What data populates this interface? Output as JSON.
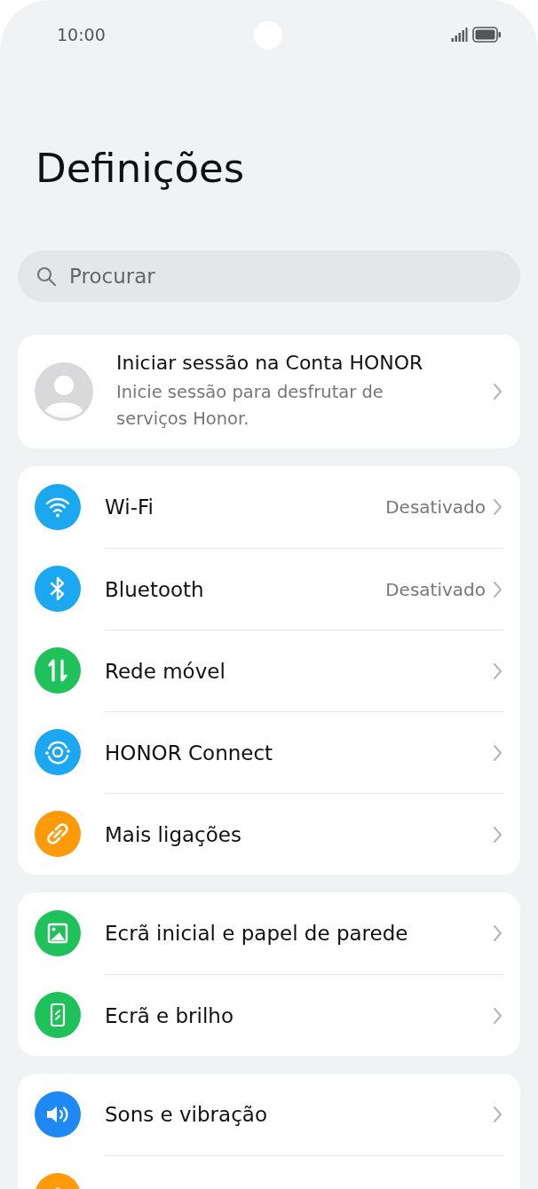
{
  "status_bar": {
    "time": "10:00"
  },
  "title": "Definições",
  "search": {
    "placeholder": "Procurar"
  },
  "account": {
    "title": "Iniciar sessão na Conta HONOR",
    "subtitle": "Inicie sessão para desfrutar de serviços Honor."
  },
  "groups": [
    {
      "items": [
        {
          "kind": "wifi",
          "color": "#1ba8f0",
          "label": "Wi-Fi",
          "value": "Desativado"
        },
        {
          "kind": "bluetooth",
          "color": "#1ba8f0",
          "label": "Bluetooth",
          "value": "Desativado"
        },
        {
          "kind": "mobile",
          "color": "#1fc15a",
          "label": "Rede móvel"
        },
        {
          "kind": "connect",
          "color": "#1ba8f0",
          "label": "HONOR Connect"
        },
        {
          "kind": "link",
          "color": "#ff9a0a",
          "label": "Mais ligações"
        }
      ]
    },
    {
      "items": [
        {
          "kind": "wallpaper",
          "color": "#1fc15a",
          "label": "Ecrã inicial e papel de parede"
        },
        {
          "kind": "display",
          "color": "#1fc15a",
          "label": "Ecrã e brilho"
        }
      ]
    },
    {
      "items": [
        {
          "kind": "sound",
          "color": "#1e88f5",
          "label": "Sons e vibração"
        },
        {
          "kind": "partial",
          "color": "#ff9a0a"
        }
      ]
    }
  ]
}
